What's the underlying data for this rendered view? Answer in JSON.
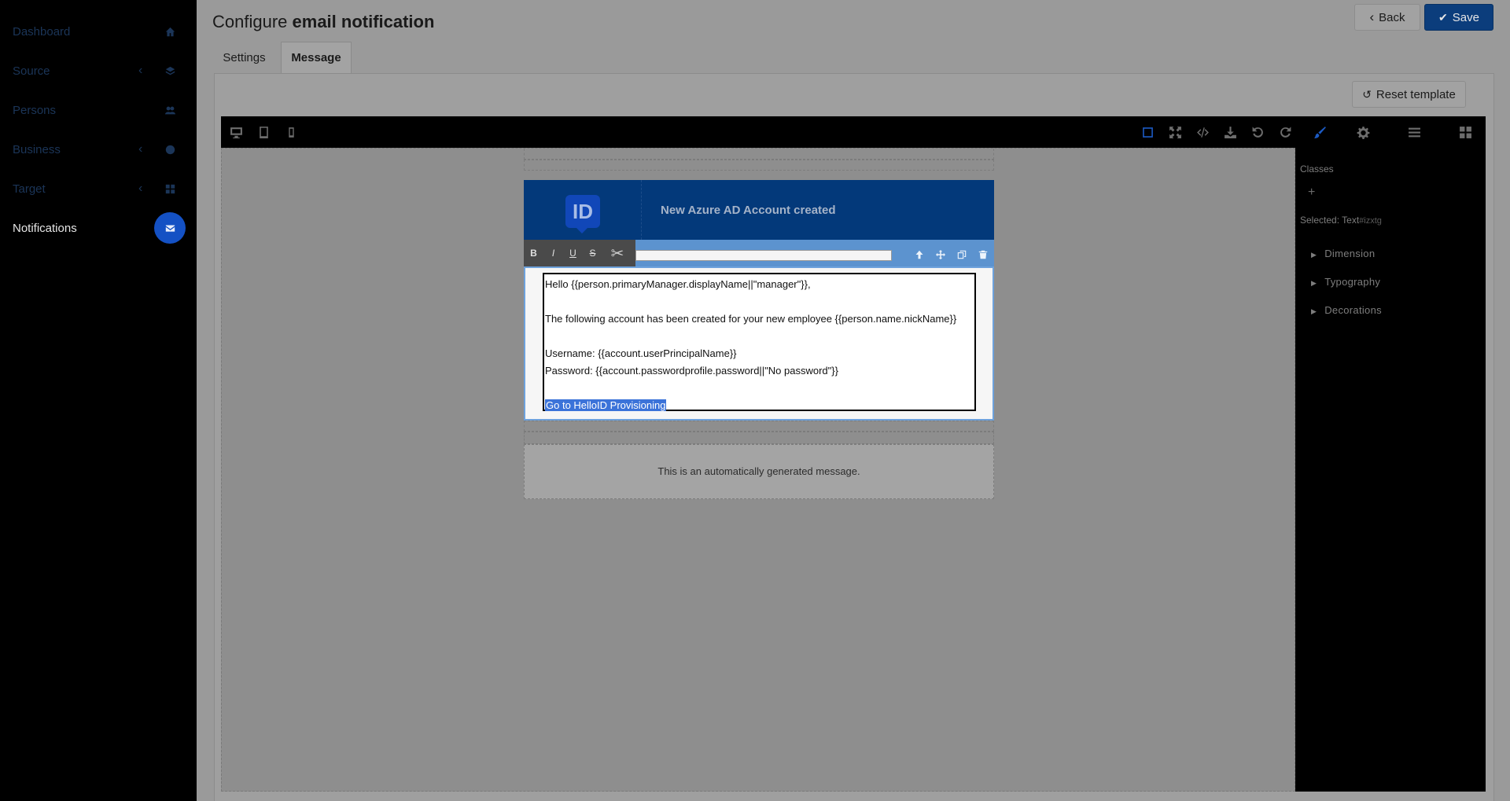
{
  "sidebar": {
    "items": [
      {
        "label": "Dashboard",
        "icon": "home-icon",
        "has_submenu": false
      },
      {
        "label": "Source",
        "icon": "layers-icon",
        "has_submenu": true
      },
      {
        "label": "Persons",
        "icon": "users-icon",
        "has_submenu": false
      },
      {
        "label": "Business",
        "icon": "globe-icon",
        "has_submenu": true
      },
      {
        "label": "Target",
        "icon": "grid-icon",
        "has_submenu": true
      },
      {
        "label": "Notifications",
        "icon": "envelope-icon",
        "has_submenu": false,
        "active": true
      }
    ],
    "chevron": "‹"
  },
  "header": {
    "title_prefix": "Configure",
    "title_bold": "email notification",
    "back_label": "Back",
    "save_label": "Save"
  },
  "tabs": [
    {
      "label": "Settings",
      "active": false
    },
    {
      "label": "Message",
      "active": true
    }
  ],
  "reset_label": "Reset template",
  "editor": {
    "toolbar_left": [
      "desktop-icon",
      "tablet-icon",
      "mobile-icon"
    ],
    "toolbar_right": [
      "outline-icon",
      "fullscreen-icon",
      "code-icon",
      "download-icon",
      "undo-icon",
      "redo-icon",
      "brush-icon",
      "gear-icon",
      "menu-icon",
      "blocks-icon"
    ],
    "rte_buttons": {
      "bold": "B",
      "italic": "I",
      "underline": "U",
      "strike": "S"
    },
    "right_panel": {
      "classes_label": "Classes",
      "add_symbol": "+",
      "selected_label": "Selected:",
      "selected_name": "Text",
      "selected_id": "#izxtg",
      "sections": [
        "Dimension",
        "Typography",
        "Decorations"
      ]
    }
  },
  "email": {
    "logo_text": "ID",
    "header_title": "New Azure AD Account created",
    "lines": {
      "greeting": "Hello {{person.primaryManager.displayName||\"manager\"}},",
      "intro": "The following account has been created for your new employee {{person.name.nickName}}",
      "username": "Username: {{account.userPrincipalName}}",
      "password": "Password: {{account.passwordprofile.password||\"No password\"}}",
      "link": "Go to HelloID Provisioning"
    },
    "footer": "This is an automatically generated message."
  },
  "colors": {
    "brand_blue": "#03397a",
    "active_nav": "#1451c4",
    "selection": "#3b73d9"
  }
}
